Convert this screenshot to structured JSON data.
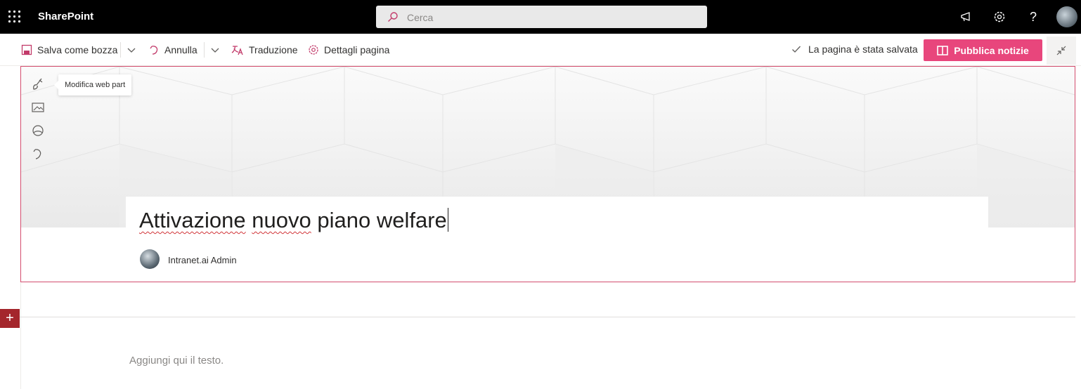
{
  "suite_bar": {
    "app_name": "SharePoint",
    "search_placeholder": "Cerca",
    "icons": [
      "app-launcher-icon",
      "search-icon",
      "megaphone-icon",
      "settings-icon",
      "help-icon",
      "user-avatar"
    ],
    "help_glyph": "?"
  },
  "command_bar": {
    "save_draft_label": "Salva come bozza",
    "undo_label": "Annulla",
    "translation_label": "Traduzione",
    "page_details_label": "Dettagli pagina",
    "saved_status": "La pagina è stata salvata",
    "publish_label": "Pubblica notizie"
  },
  "title_region": {
    "tooltip": "Modifica web part",
    "title_words": [
      "Attivazione",
      "nuovo",
      "piano welfare"
    ],
    "author": "Intranet.ai Admin"
  },
  "canvas": {
    "add_section_glyph": "+",
    "text_placeholder": "Aggiungi qui il testo."
  },
  "colors": {
    "suite_bar": "#000000",
    "accent": "#e8467c",
    "selection_border": "#d34d6e",
    "add_section": "#a4262c"
  }
}
